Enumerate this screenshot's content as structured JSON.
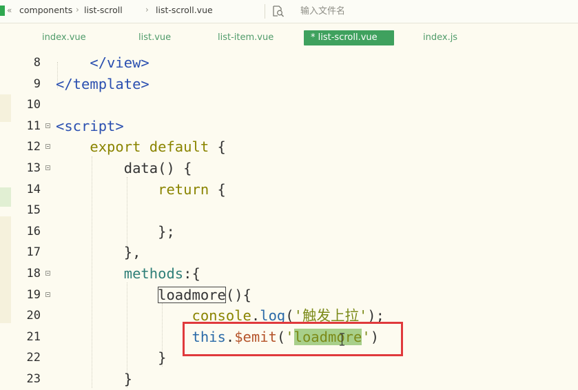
{
  "breadcrumb": {
    "start": "«",
    "items": [
      "components",
      "list-scroll",
      "list-scroll.vue"
    ],
    "separator": "›"
  },
  "search": {
    "placeholder": "输入文件名"
  },
  "tabs": [
    {
      "label": "index.vue",
      "active": false
    },
    {
      "label": "list.vue",
      "active": false
    },
    {
      "label": "list-item.vue",
      "active": false
    },
    {
      "label": "* list-scroll.vue",
      "active": true
    },
    {
      "label": "index.js",
      "active": false
    }
  ],
  "code": {
    "lines": [
      {
        "num": "8",
        "fold": false,
        "text": "    </view>"
      },
      {
        "num": "9",
        "fold": false,
        "text": "</template>"
      },
      {
        "num": "10",
        "fold": false,
        "text": ""
      },
      {
        "num": "11",
        "fold": true,
        "text": "<script>"
      },
      {
        "num": "12",
        "fold": true,
        "text": "    export default {"
      },
      {
        "num": "13",
        "fold": true,
        "text": "        data() {"
      },
      {
        "num": "14",
        "fold": false,
        "text": "            return {"
      },
      {
        "num": "15",
        "fold": false,
        "text": ""
      },
      {
        "num": "16",
        "fold": false,
        "text": "            };"
      },
      {
        "num": "17",
        "fold": false,
        "text": "        },"
      },
      {
        "num": "18",
        "fold": true,
        "text": "        methods:{"
      },
      {
        "num": "19",
        "fold": true,
        "text": "            loadmore(){"
      },
      {
        "num": "20",
        "fold": false,
        "text": "                console.log('触发上拉');"
      },
      {
        "num": "21",
        "fold": false,
        "text": "                this.$emit('loadmore')"
      },
      {
        "num": "22",
        "fold": false,
        "text": "            }"
      },
      {
        "num": "23",
        "fold": false,
        "text": "        }"
      }
    ]
  },
  "colors": {
    "accent": "#3fa15e",
    "highlight_box": "#e0393c",
    "editor_bg": "#fdfbf0"
  },
  "icons": {
    "search": "file-search-icon",
    "cursor": "text-cursor-icon"
  }
}
